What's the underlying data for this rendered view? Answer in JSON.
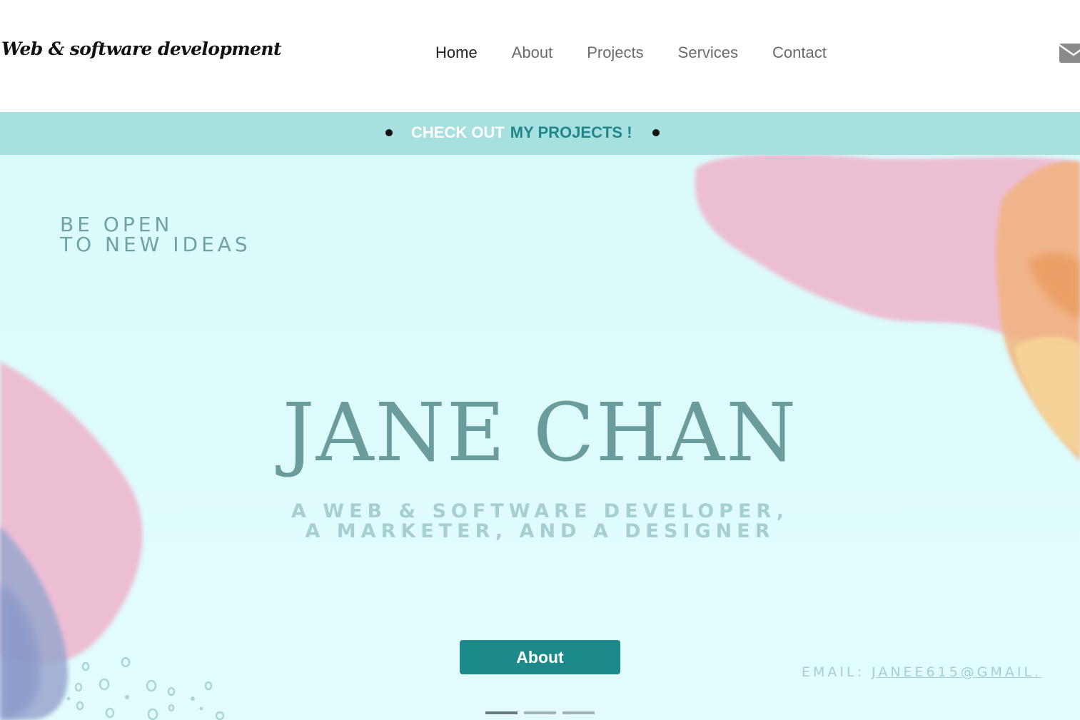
{
  "header": {
    "brand": "Web & software development",
    "nav": [
      "Home",
      "About",
      "Projects",
      "Services",
      "Contact"
    ],
    "active_nav": "Home",
    "mail_icon": "envelope-icon"
  },
  "banner": {
    "part1": "CHECK OUT",
    "part2": "MY PROJECTS !"
  },
  "hero": {
    "tagline_line1": "BE OPEN",
    "tagline_line2": "TO NEW IDEAS",
    "name": "JANE CHAN",
    "subtitle_line1": "A WEB & SOFTWARE DEVELOPER,",
    "subtitle_line2": "A MARKETER, AND A DESIGNER",
    "email_label": "EMAIL:",
    "email_value": "JANEE615@GMAIL.",
    "button_label": "About",
    "slides": 3,
    "active_slide": 1
  },
  "colors": {
    "banner_bg": "#a6e0df",
    "accent": "#1c8a8a",
    "hero_bg": "#dafafa"
  }
}
